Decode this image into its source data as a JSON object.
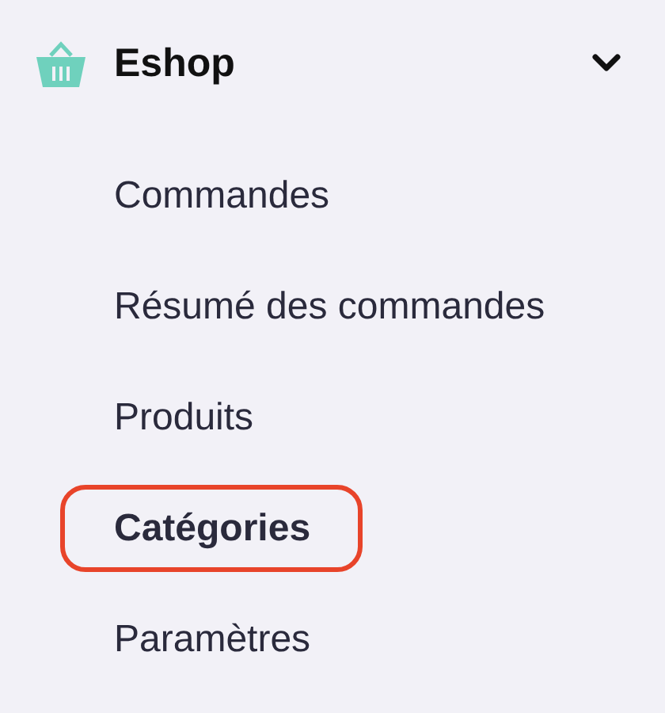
{
  "section": {
    "title": "Eshop",
    "expanded": true
  },
  "items": [
    {
      "label": "Commandes",
      "selected": false
    },
    {
      "label": "Résumé des commandes",
      "selected": false
    },
    {
      "label": "Produits",
      "selected": false
    },
    {
      "label": "Catégories",
      "selected": true
    },
    {
      "label": "Paramètres",
      "selected": false
    }
  ]
}
